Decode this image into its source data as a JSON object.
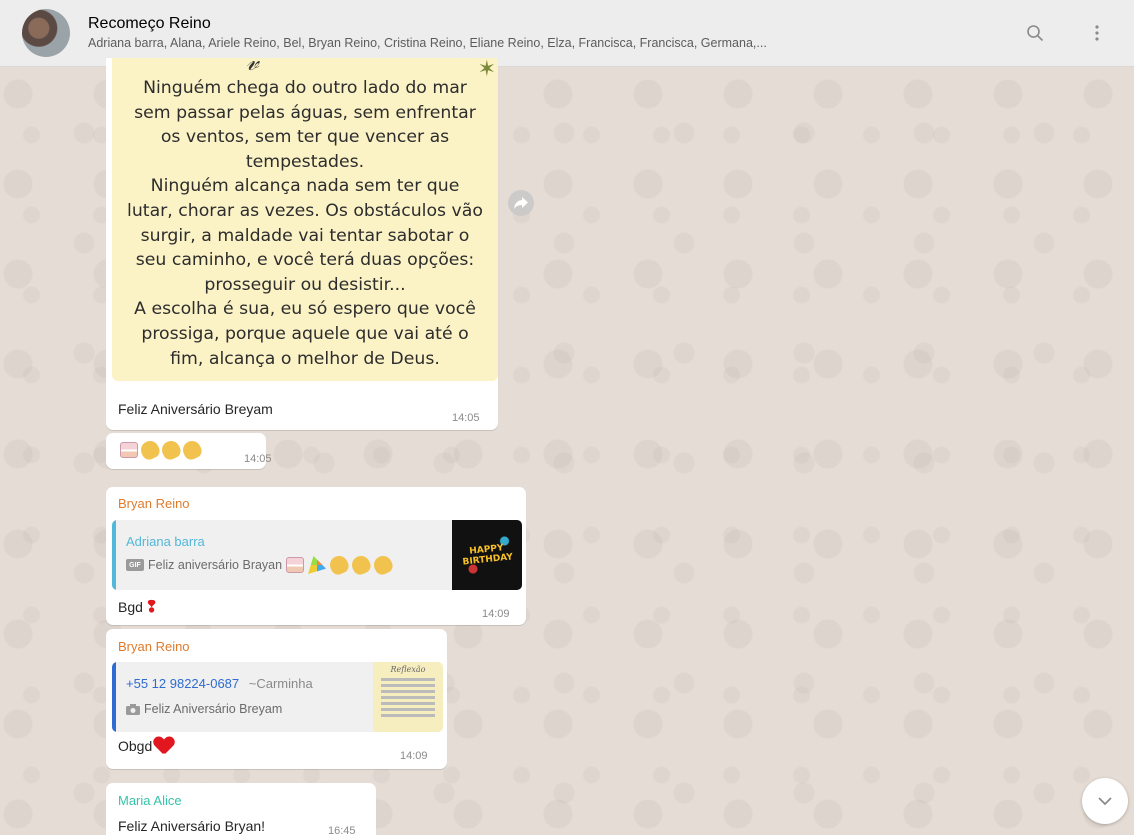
{
  "header": {
    "title": "Recomeço Reino",
    "participants": "Adriana barra, Alana, Ariele Reino, Bel, Bryan Reino, Cristina Reino, Eliane Reino, Elza, Francisca, Francisca, Germana,...",
    "search_icon": "search-icon",
    "menu_icon": "kebab-menu-icon"
  },
  "colors": {
    "sender_bryan": "#e07b2c",
    "sender_maria": "#35c4a9",
    "quote_adriana": "#52b8d9",
    "quote_number": "#2f6bd0"
  },
  "messages": {
    "image_msg": {
      "image_text": [
        "Ninguém chega do outro lado do mar",
        "sem passar pelas águas, sem enfrentar",
        "os ventos, sem ter que vencer as",
        "tempestades.",
        "Ninguém alcança nada sem ter que",
        "lutar, chorar as vezes. Os obstáculos vão",
        "surgir, a maldade vai tentar sabotar o",
        "seu caminho, e você terá duas opções:",
        "prosseguir ou desistir...",
        "A escolha é sua, eu só espero que você",
        "prossiga, porque aquele que vai até o",
        "fim, alcança o melhor de Deus."
      ],
      "caption": "Feliz Aniversário  Breyam",
      "time": "14:05"
    },
    "emoji_msg": {
      "time": "14:05"
    },
    "reply1": {
      "sender": "Bryan Reino",
      "quote_name": "Adriana barra",
      "quote_tag": "GIF",
      "quote_text": "Feliz aniversário Brayan",
      "thumb_text": "HAPPY BIRTHDAY",
      "text": "Bgd",
      "time": "14:09"
    },
    "reply2": {
      "sender": "Bryan Reino",
      "quote_number": "+55 12 98224-0687",
      "quote_alias": "~Carminha",
      "quote_text": "Feliz Aniversário  Breyam",
      "thumb_title": "Reflexão",
      "text": "Obgd",
      "time": "14:09"
    },
    "maria": {
      "sender": "Maria Alice",
      "text": "Feliz Aniversário Bryan!",
      "time": "16:45"
    }
  }
}
